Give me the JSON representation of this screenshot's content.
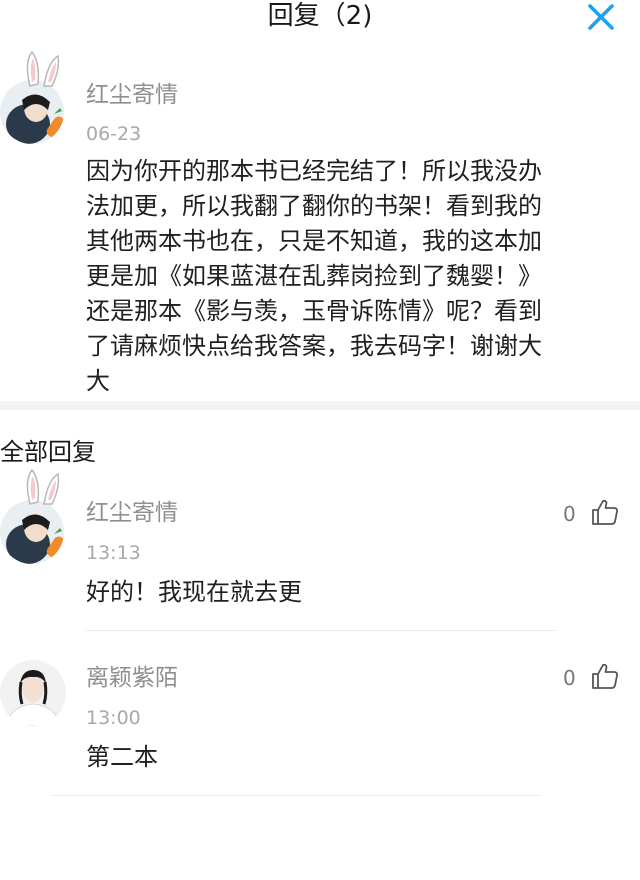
{
  "header": {
    "title": "回复（2)"
  },
  "main_comment": {
    "username": "红尘寄情",
    "date": "06-23",
    "lines": [
      "因为你开的那本书已经完结了！所以我没办",
      "法加更，所以我翻了翻你的书架！看到我的",
      "其他两本书也在，只是不知道，我的这本加",
      "更是加《如果蓝湛在乱葬岗捡到了魏婴！》",
      "还是那本《影与羡，玉骨诉陈情》呢？看到",
      "了请麻烦快点给我答案，我去码字！谢谢大",
      "大"
    ]
  },
  "replies_section": {
    "title": "全部回复"
  },
  "replies": [
    {
      "username": "红尘寄情",
      "time": "13:13",
      "text": "好的！我现在就去更",
      "likes": "0"
    },
    {
      "username": "离颖紫陌",
      "time": "13:00",
      "text": "第二本",
      "likes": "0"
    }
  ],
  "icons": {
    "close": "close-icon",
    "like": "thumbs-up-icon",
    "avatar1": "avatar-bunny-ears",
    "avatar2": "avatar-portrait"
  },
  "colors": {
    "close_icon": "#1da1f2",
    "username": "#8f8f8f",
    "separator": "#f3f3f3"
  }
}
